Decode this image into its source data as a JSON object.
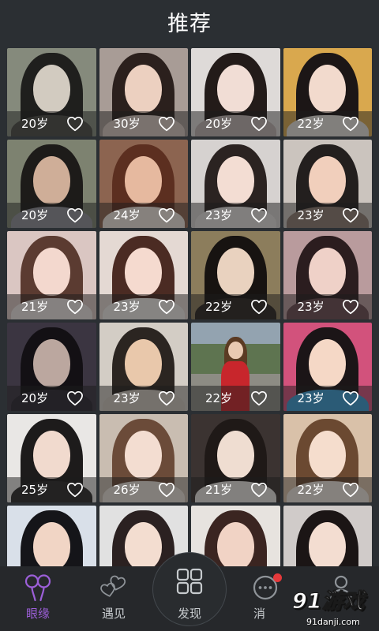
{
  "header": {
    "title": "推荐"
  },
  "colors": {
    "background": "#2b2f33",
    "nav_background": "#26282b",
    "accent": "#9c5fd8",
    "label_inactive": "#c6cacd",
    "icon_inactive": "#8f9499",
    "badge": "#e5393b"
  },
  "cards": [
    {
      "age": "20岁",
      "tone": {
        "bg": "#858a7c",
        "hair": "#1f1f1d",
        "skin": "#d2cbc0",
        "cloth": "#4a4a45"
      }
    },
    {
      "age": "30岁",
      "tone": {
        "bg": "#a89c96",
        "hair": "#2b201d",
        "skin": "#ecd0c0",
        "cloth": "#d8c8c0"
      }
    },
    {
      "age": "20岁",
      "tone": {
        "bg": "#dedad8",
        "hair": "#231b19",
        "skin": "#f1ddd5",
        "cloth": "#bfb3b0"
      }
    },
    {
      "age": "22岁",
      "tone": {
        "bg": "#d9a84e",
        "hair": "#1c1616",
        "skin": "#f2dacd",
        "cloth": "#e6e2dc"
      }
    },
    {
      "age": "20岁",
      "tone": {
        "bg": "#7d8270",
        "hair": "#1d1b19",
        "skin": "#cfae98",
        "cloth": "#8e8f96"
      }
    },
    {
      "age": "24岁",
      "tone": {
        "bg": "#8c6450",
        "hair": "#5c2f20",
        "skin": "#e6b99f",
        "cloth": "#f0e6de"
      }
    },
    {
      "age": "23岁",
      "tone": {
        "bg": "#d6d2d0",
        "hair": "#2b2321",
        "skin": "#f3ddd3",
        "cloth": "#e4e0de"
      }
    },
    {
      "age": "23岁",
      "tone": {
        "bg": "#cbc4be",
        "hair": "#231f1e",
        "skin": "#f1cfbc",
        "cloth": "#8c7a70"
      }
    },
    {
      "age": "21岁",
      "tone": {
        "bg": "#dac6c2",
        "hair": "#5b3b31",
        "skin": "#f3d8ce",
        "cloth": "#efe7e4"
      }
    },
    {
      "age": "23岁",
      "tone": {
        "bg": "#e4d9d3",
        "hair": "#4b2b23",
        "skin": "#f5dacf",
        "cloth": "#f0ece8"
      }
    },
    {
      "age": "22岁",
      "tone": {
        "bg": "#8c7d5c",
        "hair": "#171311",
        "skin": "#e9d2bf",
        "cloth": "#2a2420"
      }
    },
    {
      "age": "23岁",
      "tone": {
        "bg": "#b99b9d",
        "hair": "#2b1d1f",
        "skin": "#efd1c8",
        "cloth": "#6a4a50"
      }
    },
    {
      "age": "20岁",
      "tone": {
        "bg": "#3b3541",
        "hair": "#131014",
        "skin": "#bba79f",
        "cloth": "#2a2630"
      }
    },
    {
      "age": "23岁",
      "tone": {
        "bg": "#d3cdc5",
        "hair": "#2b2521",
        "skin": "#e9c8ab",
        "cloth": "#cfc6bc"
      }
    },
    {
      "age": "22岁",
      "tone": {
        "bg": "#617552",
        "hair": "#5b3b23",
        "skin": "#e9cab2",
        "cloth": "#c8262c"
      }
    },
    {
      "age": "23岁",
      "tone": {
        "bg": "#d2527c",
        "hair": "#1b1517",
        "skin": "#f5d8c6",
        "cloth": "#3a9ad0"
      }
    },
    {
      "age": "25岁",
      "tone": {
        "bg": "#e9e7e5",
        "hair": "#1d1b1b",
        "skin": "#f1dace",
        "cloth": "#2a2828"
      }
    },
    {
      "age": "26岁",
      "tone": {
        "bg": "#c9bdb1",
        "hair": "#6b4b39",
        "skin": "#f3ddd1",
        "cloth": "#e8e0d8"
      }
    },
    {
      "age": "21岁",
      "tone": {
        "bg": "#3b3331",
        "hair": "#1f1917",
        "skin": "#efddd1",
        "cloth": "#e8e4e0"
      }
    },
    {
      "age": "22岁",
      "tone": {
        "bg": "#d9c1a9",
        "hair": "#6b4931",
        "skin": "#f5ddcd",
        "cloth": "#efe6de"
      }
    },
    {
      "tone": {
        "bg": "#d9e0e9",
        "hair": "#151519",
        "skin": "#f1d5c5",
        "cloth": "#e8e8ee"
      }
    },
    {
      "tone": {
        "bg": "#e1e1e1",
        "hair": "#2b2121",
        "skin": "#f3ddd0",
        "cloth": "#d8d2ce"
      }
    },
    {
      "tone": {
        "bg": "#e7e3df",
        "hair": "#3b2521",
        "skin": "#f1d3c5",
        "cloth": "#f4f0ec"
      }
    },
    {
      "tone": {
        "bg": "#d0cbc9",
        "hair": "#1b1515",
        "skin": "#f3ddd1",
        "cloth": "#7a7270"
      }
    }
  ],
  "nav": {
    "tabs": [
      {
        "label": "眼缘",
        "icon": "balloons-icon",
        "active": true
      },
      {
        "label": "遇见",
        "icon": "two-hearts-icon",
        "active": false
      },
      {
        "label": "发现",
        "icon": "grid-squares-icon",
        "active": false
      },
      {
        "label": "消息",
        "icon": "chat-bubble-icon",
        "active": false,
        "badge": true
      },
      {
        "icon": "person-icon",
        "active": false
      }
    ]
  },
  "watermark": {
    "logo": "91游戏",
    "site": "91danji.com"
  }
}
